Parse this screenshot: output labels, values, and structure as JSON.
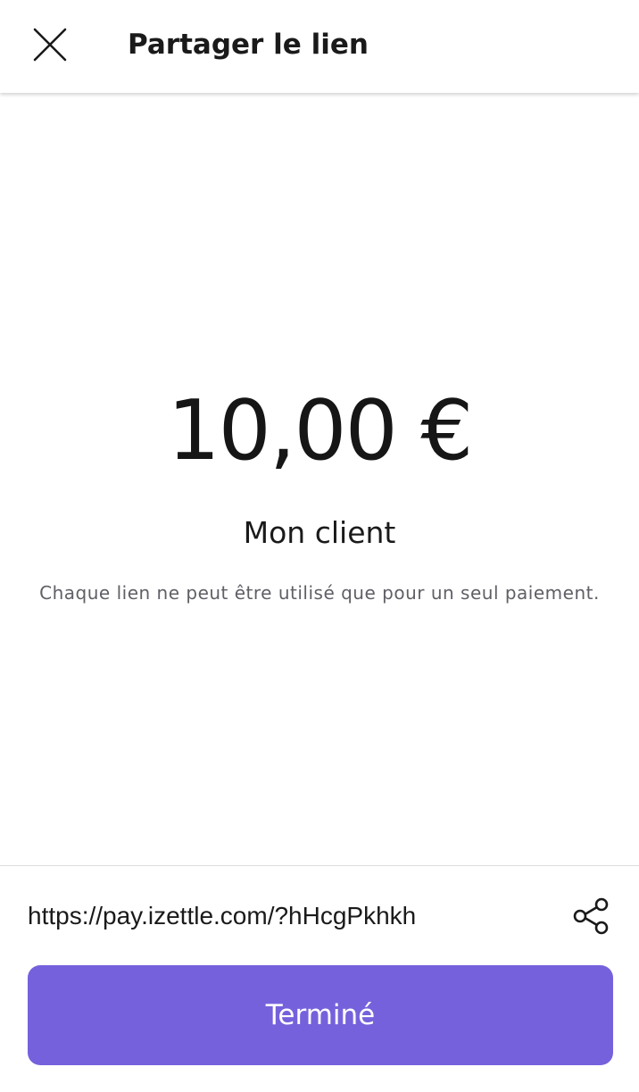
{
  "header": {
    "title": "Partager le lien",
    "close_icon": "close-icon"
  },
  "main": {
    "amount": "10,00 €",
    "customer_name": "Mon client",
    "info_text": "Chaque lien ne peut être utilisé que pour un seul paiement."
  },
  "footer": {
    "link_url": "https://pay.izettle.com/?hHcgPkhkh",
    "share_icon": "share-icon",
    "done_label": "Terminé"
  },
  "colors": {
    "accent": "#7661dc",
    "text_primary": "#1a1a1a",
    "text_secondary": "#5f5f66",
    "divider": "#dddddd"
  }
}
